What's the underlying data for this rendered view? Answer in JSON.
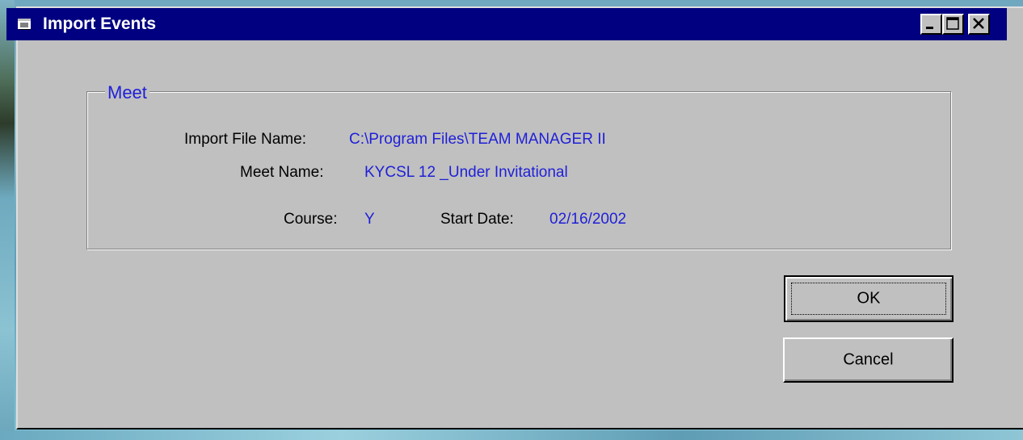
{
  "window": {
    "title": "Import Events",
    "controls": {
      "minimize_icon": "minimize-icon",
      "maximize_icon": "maximize-icon",
      "close_icon": "close-icon"
    }
  },
  "meet": {
    "group_label": "Meet",
    "import_file_name_label": "Import File Name:",
    "import_file_name_value": "C:\\Program Files\\TEAM MANAGER II",
    "meet_name_label": "Meet Name:",
    "meet_name_value": "KYCSL  12 _Under Invitational",
    "course_label": "Course:",
    "course_value": "Y",
    "start_date_label": "Start Date:",
    "start_date_value": "02/16/2002"
  },
  "buttons": {
    "ok_label": "OK",
    "cancel_label": "Cancel"
  },
  "colors": {
    "titlebar": "#000080",
    "dialog_face": "#c0c0c0",
    "value_text": "#1f1fd8"
  }
}
